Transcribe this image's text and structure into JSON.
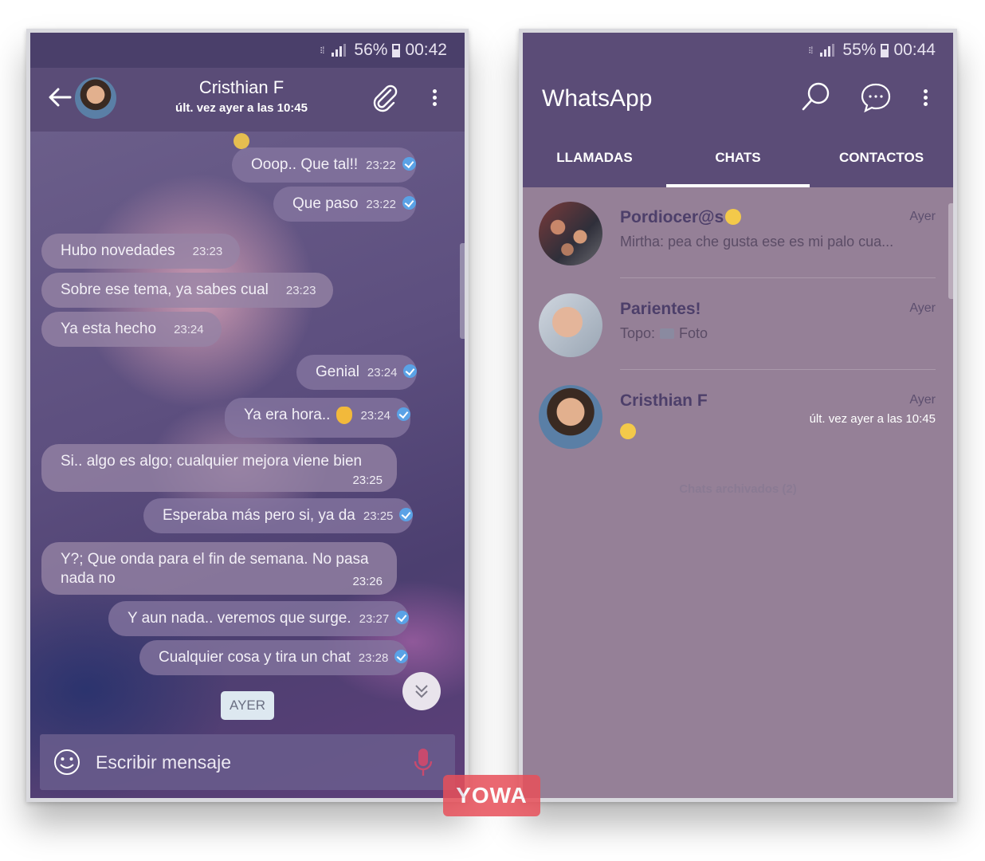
{
  "left_screen": {
    "status": {
      "battery": "56%",
      "time": "00:42"
    },
    "header": {
      "contact_name": "Cristhian F",
      "last_seen": "últ. vez ayer a las 10:45"
    },
    "messages": [
      {
        "text": "Ooop.. Que tal!!",
        "time": "23:22",
        "dir": "out"
      },
      {
        "text": "Que paso",
        "time": "23:22",
        "dir": "out"
      },
      {
        "text": "Hubo novedades",
        "time": "23:23",
        "dir": "in"
      },
      {
        "text": "Sobre ese tema, ya sabes cual",
        "time": "23:23",
        "dir": "in"
      },
      {
        "text": "Ya esta hecho",
        "time": "23:24",
        "dir": "in"
      },
      {
        "text": "Genial",
        "time": "23:24",
        "dir": "out"
      },
      {
        "text": "Ya era hora..",
        "time": "23:24",
        "dir": "out"
      },
      {
        "text": "Si.. algo es algo; cualquier mejora viene bien",
        "time": "23:25",
        "dir": "in"
      },
      {
        "text": "Esperaba más pero si, ya da",
        "time": "23:25",
        "dir": "out"
      },
      {
        "text": "Y?; Que onda para el fin de semana.  No pasa nada no",
        "time": "23:26",
        "dir": "in"
      },
      {
        "text": "Y aun nada.. veremos que surge.",
        "time": "23:27",
        "dir": "out"
      },
      {
        "text": "Cualquier cosa y tira un chat",
        "time": "23:28",
        "dir": "out"
      }
    ],
    "date_chip": "AYER",
    "input": {
      "placeholder": "Escribir mensaje"
    }
  },
  "right_screen": {
    "status": {
      "battery": "55%",
      "time": "00:44"
    },
    "app_title": "WhatsApp",
    "tabs": [
      "LLAMADAS",
      "CHATS",
      "CONTACTOS"
    ],
    "active_tab": "CHATS",
    "chats": [
      {
        "name": "Pordiocer@s",
        "time": "Ayer",
        "preview": "Mirtha: pea che gusta ese es mi palo cua..."
      },
      {
        "name": "Parientes!",
        "time": "Ayer",
        "preview_prefix": "Topo:",
        "preview": "Foto"
      },
      {
        "name": "Cristhian F",
        "time": "Ayer",
        "subtitle": "últ. vez ayer a las 10:45"
      }
    ],
    "archived_label": "Chats archivados (2)"
  },
  "watermark": "YOWA",
  "colors": {
    "header_purple": "#5b4c77",
    "list_background": "#958097",
    "read_tick": "#5aa2e6",
    "watermark_red": "#e8505a"
  }
}
